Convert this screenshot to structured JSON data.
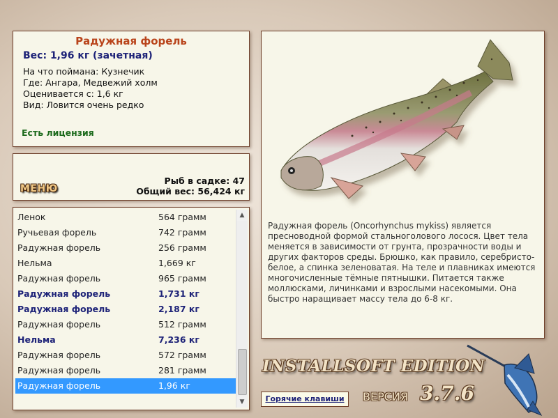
{
  "info": {
    "fish_name": "Радужная форель",
    "weight_line": "Вес: 1,96 кг (зачетная)",
    "details": [
      "На что поймана: Кузнечик",
      "Где: Ангара, Медвежий холм",
      "Оценивается с: 1,6 кг",
      "Вид: Ловится очень редко"
    ],
    "license": "Есть лицензия"
  },
  "catch": {
    "menu_label": "МЕНЮ",
    "fish_count": "Рыб в садке: 47",
    "total_weight": "Общий вес: 56,424 кг"
  },
  "list": {
    "rows": [
      {
        "name": "Ленок",
        "weight": "564 грамм",
        "style": "normal"
      },
      {
        "name": "Ручьевая форель",
        "weight": "742 грамм",
        "style": "normal"
      },
      {
        "name": "Радужная форель",
        "weight": "256 грамм",
        "style": "normal"
      },
      {
        "name": "Нельма",
        "weight": "1,669 кг",
        "style": "normal"
      },
      {
        "name": "Радужная форель",
        "weight": "965 грамм",
        "style": "normal"
      },
      {
        "name": "Радужная форель",
        "weight": "1,731 кг",
        "style": "bold"
      },
      {
        "name": "Радужная форель",
        "weight": "2,187 кг",
        "style": "bold"
      },
      {
        "name": "Радужная форель",
        "weight": "512 грамм",
        "style": "normal"
      },
      {
        "name": "Нельма",
        "weight": "7,236 кг",
        "style": "bold"
      },
      {
        "name": "Радужная форель",
        "weight": "572 грамм",
        "style": "normal"
      },
      {
        "name": "Радужная форель",
        "weight": "281 грамм",
        "style": "normal"
      },
      {
        "name": "Радужная форель",
        "weight": "1,96 кг",
        "style": "selected"
      }
    ],
    "scroll_up": "▲",
    "scroll_down": "▼"
  },
  "description": "Радужная форель (Oncorhynchus mykiss) является пресноводной формой стальноголового лосося. Цвет тела меняется в зависимости от грунта, прозрачности воды и других факторов среды. Брюшко, как правило, серебристо-белое, а спинка зеленоватая. На теле и плавниках имеются многочисленные тёмные пятнышки. Питается также моллюсками, личинками и взрослыми насекомыми. Она быстро наращивает массу тела до 6-8 кг.",
  "footer": {
    "hotkeys": "Горячие клавиши",
    "edition": "INSTALLSOFT EDITION",
    "version_label": "ВЕРСИЯ",
    "version_number": "3.7.6"
  },
  "colors": {
    "title": "#b9441b",
    "weight": "#1e2378",
    "license": "#1c6a1c",
    "selection": "#3399ff",
    "panel_bg": "#f7f6e9",
    "panel_border": "#6e3f2a"
  }
}
